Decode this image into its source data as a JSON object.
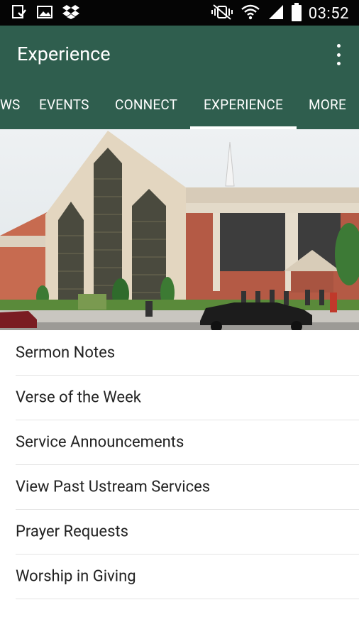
{
  "status_bar": {
    "time": "03:52",
    "left_icons": [
      "download-done-icon",
      "image-icon",
      "dropbox-icon"
    ],
    "right_icons": [
      "vibrate-mute-icon",
      "wifi-icon",
      "signal-icon",
      "battery-icon"
    ]
  },
  "app_bar": {
    "title": "Experience",
    "menu_icon": "overflow-menu-icon"
  },
  "tabs": [
    {
      "label": "WS"
    },
    {
      "label": "EVENTS"
    },
    {
      "label": "CONNECT"
    },
    {
      "label": "EXPERIENCE",
      "active": true
    },
    {
      "label": "MORE"
    }
  ],
  "list": {
    "items": [
      {
        "label": "Sermon Notes"
      },
      {
        "label": "Verse of the Week"
      },
      {
        "label": "Service Announcements"
      },
      {
        "label": "View Past Ustream Services"
      },
      {
        "label": "Prayer Requests"
      },
      {
        "label": "Worship in Giving"
      }
    ]
  },
  "colors": {
    "app_bar": "#2f5e4e",
    "status_bar": "#050505",
    "divider": "#e4e4e4"
  }
}
